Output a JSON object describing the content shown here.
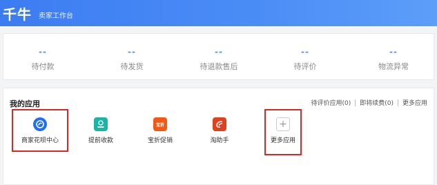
{
  "header": {
    "brand": "千牛",
    "subtitle": "卖家工作台"
  },
  "stats": [
    {
      "value": "--",
      "label": "待付款"
    },
    {
      "value": "--",
      "label": "待发货"
    },
    {
      "value": "--",
      "label": "待退款售后"
    },
    {
      "value": "--",
      "label": "待评价"
    },
    {
      "value": "--",
      "label": "物流异常"
    }
  ],
  "apps": {
    "title": "我的应用",
    "links": [
      "待评价应用(0)",
      "即将续费(0)",
      "更多应用"
    ],
    "items": [
      {
        "label": "商家花呗中心",
        "icon": "huabei-icon",
        "color": "#1e6ff5"
      },
      {
        "label": "提前收款",
        "icon": "early-payment-icon",
        "color": "#1bb5a8"
      },
      {
        "label": "宝折促销",
        "icon": "discount-promo-icon",
        "color": "#f05a14",
        "icon_text": "宝折"
      },
      {
        "label": "淘助手",
        "icon": "taozhushou-icon",
        "color": "#e0401e"
      },
      {
        "label": "更多应用",
        "icon": "plus-icon"
      }
    ]
  }
}
